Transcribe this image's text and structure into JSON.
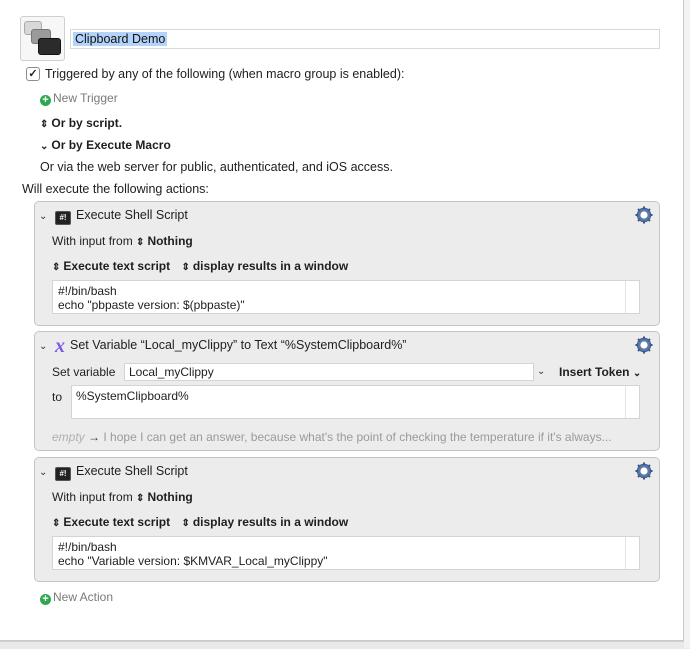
{
  "macro": {
    "title": "Clipboard Demo",
    "triggered_label": "Triggered by any of the following (when macro group is enabled):",
    "triggered_checked": true,
    "new_trigger_label": "New Trigger",
    "or_by_script_label": "Or by script.",
    "or_by_execute_macro_label": "Or by Execute Macro",
    "web_server_text": "Or via the web server for public, authenticated, and iOS access.",
    "will_execute_label": "Will execute the following actions:"
  },
  "actions": [
    {
      "title": "Execute Shell Script",
      "with_input_label": "With input from",
      "input_source": "Nothing",
      "exec_mode": "Execute text script",
      "output_mode": "display results in a window",
      "code_line1": "#!/bin/bash",
      "code_line2": "echo \"pbpaste version: $(pbpaste)\""
    },
    {
      "title": "Set Variable “Local_myClippy” to Text “%SystemClipboard%”",
      "set_variable_label": "Set variable",
      "variable_name": "Local_myClippy",
      "insert_token_label": "Insert Token",
      "to_label": "to",
      "to_value": "%SystemClipboard%",
      "preview_empty": "empty",
      "preview_arrow": "→",
      "preview_text": "I hope I can get an answer, because what's the point of checking the temperature if it's always..."
    },
    {
      "title": "Execute Shell Script",
      "with_input_label": "With input from",
      "input_source": "Nothing",
      "exec_mode": "Execute text script",
      "output_mode": "display results in a window",
      "code_line1": "#!/bin/bash",
      "code_line2": "echo \"Variable version: $KMVAR_Local_myClippy\""
    }
  ],
  "new_action_label": "New Action",
  "icons": {
    "macro": "macro-screens-icon",
    "plus": "plus-circle-icon",
    "terminal": "terminal-icon",
    "variable": "variable-x-icon",
    "gear": "gear-icon",
    "chevron": "chevron-down-icon",
    "updown": "updown-arrow-icon"
  },
  "colors": {
    "accent_green": "#2fa84f",
    "variable_purple": "#7a5be6",
    "selection": "#b3d3fb"
  }
}
